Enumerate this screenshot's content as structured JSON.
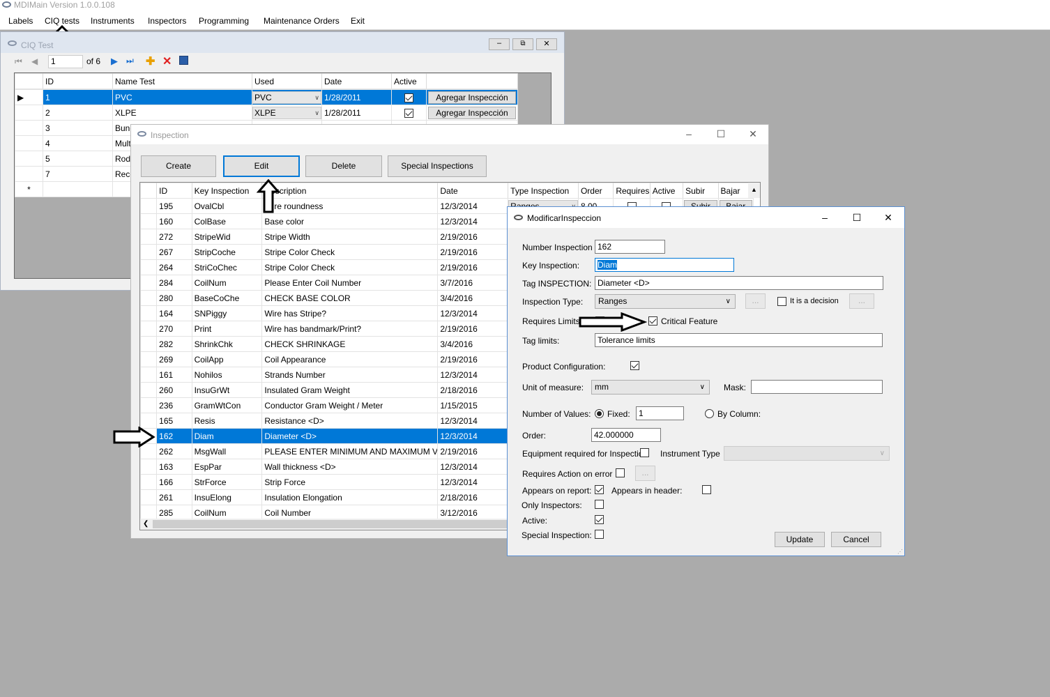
{
  "main_window": {
    "title": "MDIMain Version 1.0.0.108",
    "menu": [
      "Labels",
      "CIQ tests",
      "Instruments",
      "Inspectors",
      "Programming",
      "Maintenance Orders",
      "Exit"
    ]
  },
  "ciq_window": {
    "title": "CIQ Test",
    "nav": {
      "position": "1",
      "of_label": "of 6"
    },
    "columns": [
      "ID",
      "Name Test",
      "Used",
      "Date",
      "Active"
    ],
    "rows": [
      {
        "id": "1",
        "name": "PVC",
        "used": "PVC",
        "date": "1/28/2011",
        "button": "Agregar Inspección"
      },
      {
        "id": "2",
        "name": "XLPE",
        "used": "XLPE",
        "date": "1/28/2011",
        "button": "Agregar Inspección"
      },
      {
        "id": "3",
        "name": "Bunc"
      },
      {
        "id": "4",
        "name": "Multi"
      },
      {
        "id": "5",
        "name": "Rodl"
      },
      {
        "id": "7",
        "name": "Reco"
      }
    ],
    "new_row_marker": "*"
  },
  "inspection_window": {
    "title": "Inspection",
    "buttons": {
      "create": "Create",
      "edit": "Edit",
      "delete": "Delete",
      "special": "Special Inspections"
    },
    "columns": [
      "ID",
      "Key Inspection",
      "Description",
      "Date",
      "Type Inspection",
      "Order",
      "Requires",
      "Active",
      "Subir",
      "Bajar"
    ],
    "first_row_extra": {
      "type": "Ranges",
      "order": "8.00",
      "subir": "Subir",
      "bajar": "Bajar"
    },
    "rows": [
      {
        "id": "195",
        "key": "OvalCbl",
        "desc": "Wire roundness",
        "date": "12/3/2014"
      },
      {
        "id": "160",
        "key": "ColBase",
        "desc": "Base color",
        "date": "12/3/2014"
      },
      {
        "id": "272",
        "key": "StripeWid",
        "desc": "Stripe Width",
        "date": "2/19/2016"
      },
      {
        "id": "267",
        "key": "StripCoche",
        "desc": "Stripe Color Check",
        "date": "2/19/2016"
      },
      {
        "id": "264",
        "key": "StriCoChec",
        "desc": "Stripe Color Check",
        "date": "2/19/2016"
      },
      {
        "id": "284",
        "key": "CoilNum",
        "desc": "Please Enter Coil Number",
        "date": "3/7/2016"
      },
      {
        "id": "280",
        "key": "BaseCoChe",
        "desc": "CHECK BASE COLOR",
        "date": "3/4/2016"
      },
      {
        "id": "164",
        "key": "SNPiggy",
        "desc": "Wire has Stripe?",
        "date": "12/3/2014"
      },
      {
        "id": "270",
        "key": "Print",
        "desc": "Wire has bandmark/Print?",
        "date": "2/19/2016"
      },
      {
        "id": "282",
        "key": "ShrinkChk",
        "desc": "CHECK SHRINKAGE",
        "date": "3/4/2016"
      },
      {
        "id": "269",
        "key": "CoilApp",
        "desc": "Coil Appearance",
        "date": "2/19/2016"
      },
      {
        "id": "161",
        "key": "Nohilos",
        "desc": "Strands Number",
        "date": "12/3/2014"
      },
      {
        "id": "260",
        "key": "InsuGrWt",
        "desc": "Insulated Gram Weight",
        "date": "2/18/2016"
      },
      {
        "id": "236",
        "key": "GramWtCon",
        "desc": "Conductor Gram Weight / Meter",
        "date": "1/15/2015"
      },
      {
        "id": "165",
        "key": "Resis",
        "desc": "Resistance <D>",
        "date": "12/3/2014"
      },
      {
        "id": "162",
        "key": "Diam",
        "desc": "Diameter <D>",
        "date": "12/3/2014"
      },
      {
        "id": "262",
        "key": "MsgWall",
        "desc": "PLEASE ENTER MINIMUM AND MAXIMUM VA...",
        "date": "2/19/2016"
      },
      {
        "id": "163",
        "key": "EspPar",
        "desc": "Wall thickness <D>",
        "date": "12/3/2014"
      },
      {
        "id": "166",
        "key": "StrForce",
        "desc": "Strip Force",
        "date": "12/3/2014"
      },
      {
        "id": "261",
        "key": "InsuElong",
        "desc": "Insulation Elongation",
        "date": "2/18/2016"
      },
      {
        "id": "285",
        "key": "CoilNum",
        "desc": "Coil Number",
        "date": "3/12/2016"
      }
    ]
  },
  "modify_window": {
    "title": "ModificarInspeccion",
    "labels": {
      "number": "Number Inspection",
      "key": "Key Inspection:",
      "tag": "Tag INSPECTION:",
      "type": "Inspection Type:",
      "decision": "It is a decision",
      "requires_limits": "Requires Limits",
      "critical": "Critical Feature",
      "tag_limits": "Tag limits:",
      "product_config": "Product Configuration:",
      "unit": "Unit of measure:",
      "mask": "Mask:",
      "num_values": "Number of Values:",
      "fixed": "Fixed:",
      "by_column": "By Column:",
      "order": "Order:",
      "equipment": "Equipment required for Inspection",
      "instrument_type": "Instrument Type",
      "action_error": "Requires Action on error",
      "appears_report": "Appears on report:",
      "appears_header": "Appears in header:",
      "only_inspectors": "Only Inspectors:",
      "active": "Active:",
      "special": "Special Inspection:"
    },
    "values": {
      "number": "162",
      "key": "Diam",
      "tag": "Diameter <D>",
      "type": "Ranges",
      "tag_limits": "Tolerance limits",
      "unit": "mm",
      "mask": "",
      "fixed": "1",
      "order": "42.000000",
      "ellipsis": "..."
    },
    "buttons": {
      "update": "Update",
      "cancel": "Cancel"
    }
  }
}
